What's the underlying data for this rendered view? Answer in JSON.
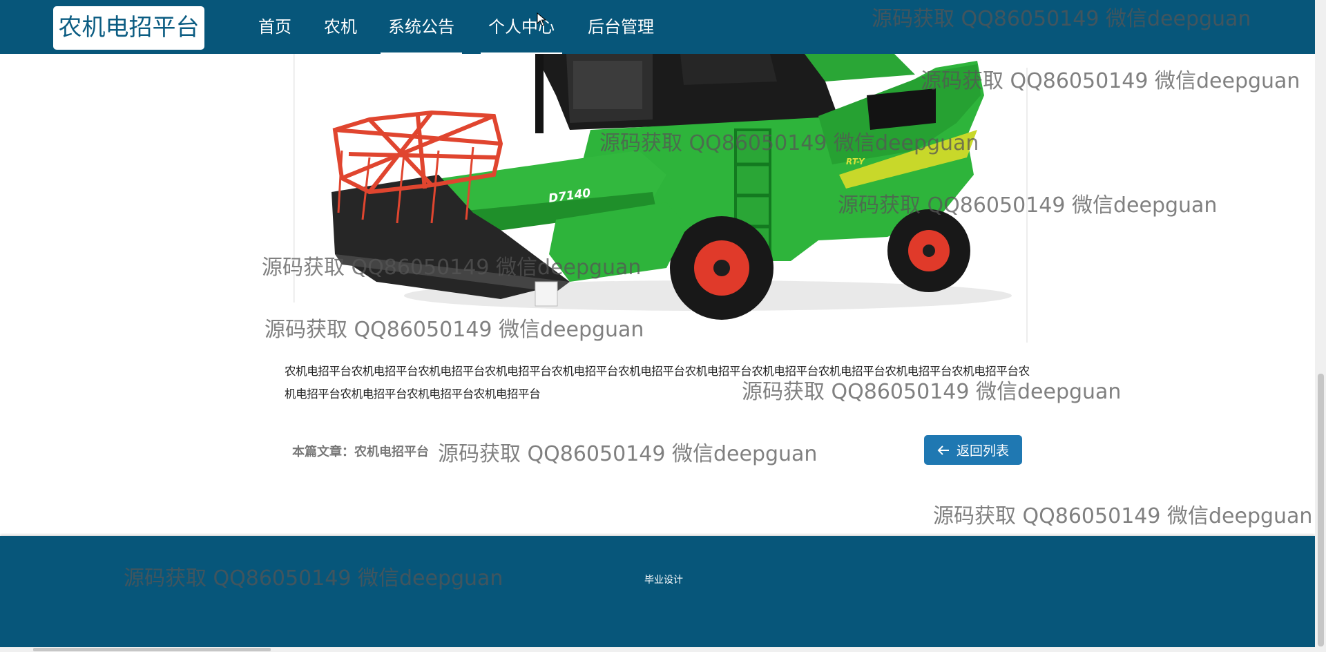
{
  "header": {
    "logo": "农机电招平台",
    "nav": [
      {
        "label": "首页"
      },
      {
        "label": "农机"
      },
      {
        "label": "系统公告"
      },
      {
        "label": "个人中心"
      },
      {
        "label": "后台管理"
      }
    ],
    "active_index": 2
  },
  "product": {
    "model_label": "D7140",
    "side_label": "RT-Y",
    "colors": {
      "body": "#2db43a",
      "header_reel": "#e0452f",
      "frame": "#161616"
    }
  },
  "article": {
    "body": "农机电招平台农机电招平台农机电招平台农机电招平台农机电招平台农机电招平台农机电招平台农机电招平台农机电招平台农机电招平台农机电招平台农机电招平台农机电招平台农机电招平台农机电招平台",
    "meta": "本篇文章：农机电招平台",
    "back_button": "返回列表"
  },
  "footer": {
    "text": "毕业设计"
  },
  "watermark": "源码获取 QQ86050149 微信deepguan",
  "colors": {
    "header_bg": "#07567a",
    "footer_bg": "#07567a",
    "button_bg": "#1f78b2"
  }
}
